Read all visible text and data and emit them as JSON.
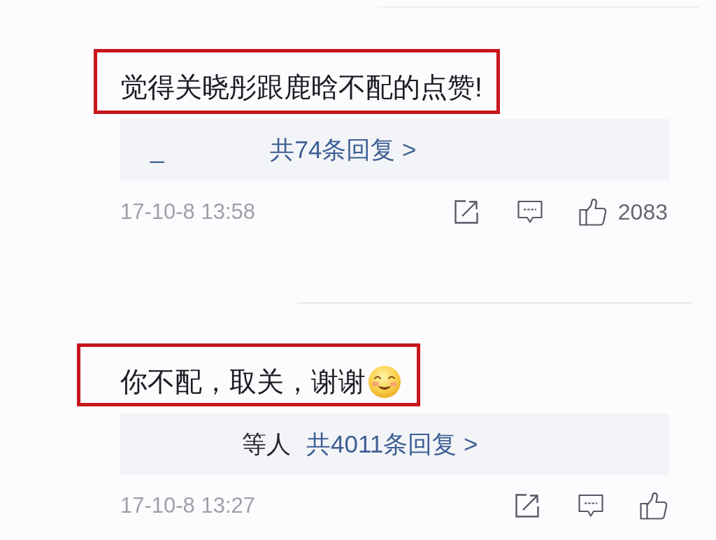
{
  "comments": [
    {
      "text": "觉得关晓彤跟鹿晗不配的点赞!",
      "highlighted": true,
      "replies": {
        "names": "_",
        "summary": "共74条回复 >"
      },
      "time": "17-10-8 13:58",
      "likes": "2083"
    },
    {
      "text": "你不配，取关，谢谢",
      "highlighted": true,
      "emoji": true,
      "replies": {
        "suffix": "等人",
        "summary": "共4011条回复 >"
      },
      "time": "17-10-8 13:27"
    }
  ]
}
